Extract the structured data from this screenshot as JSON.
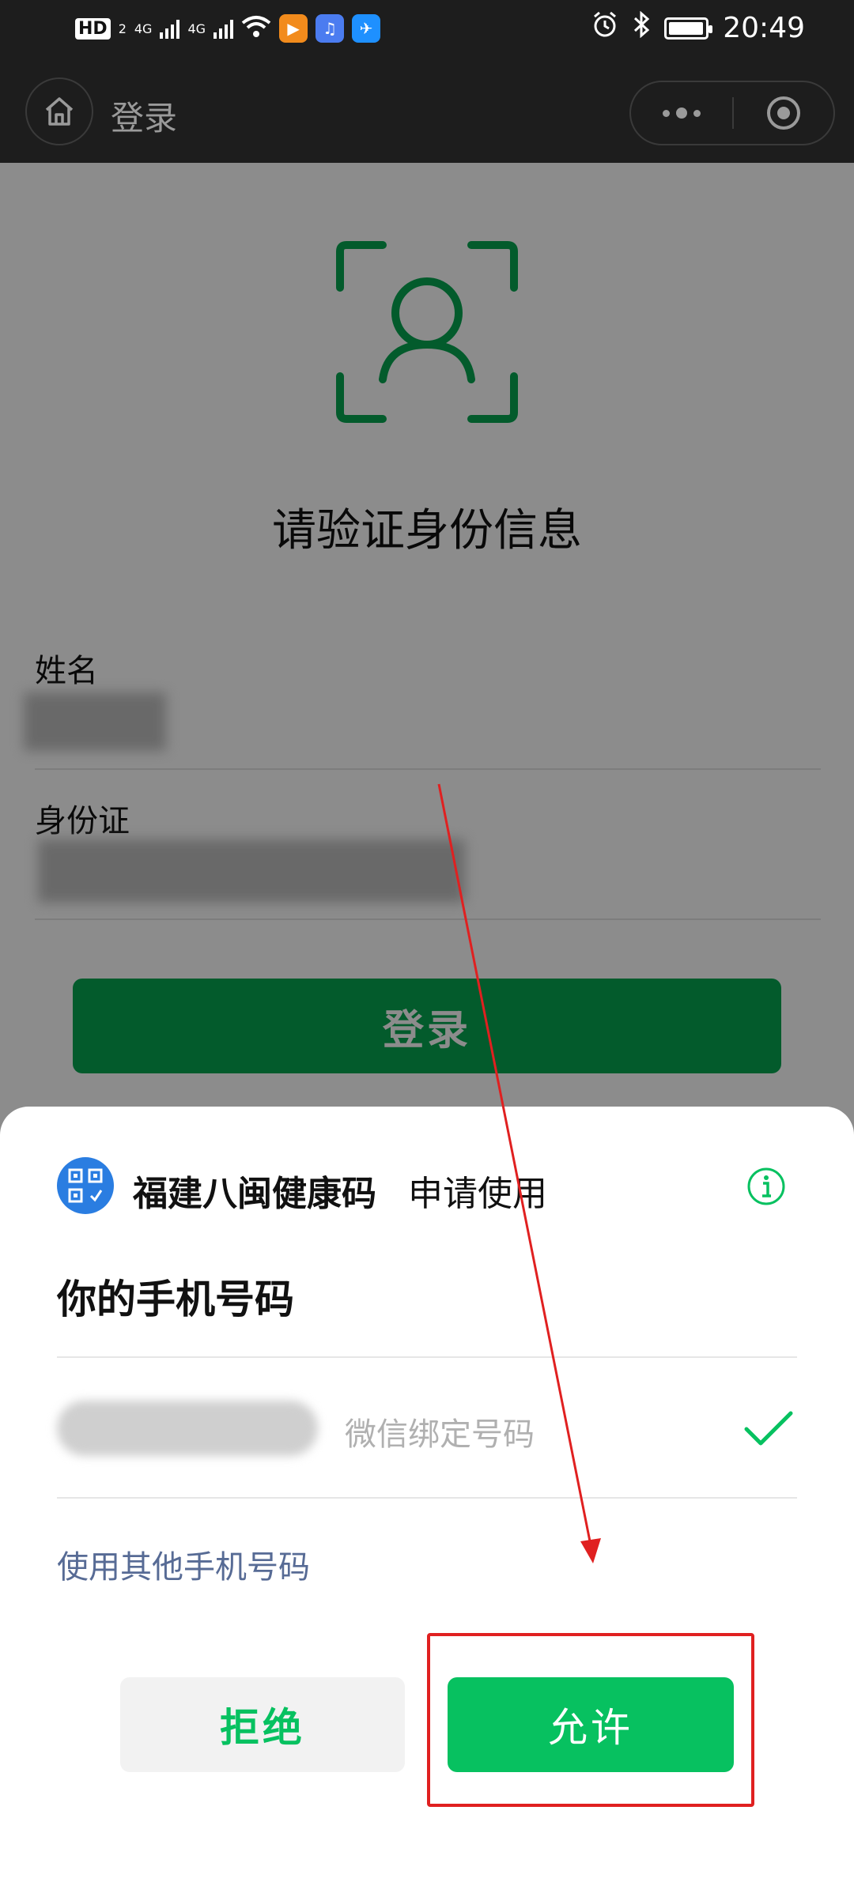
{
  "status_bar": {
    "hd_label": "HD",
    "sim_label": "2",
    "network_1": "4G",
    "network_2": "4G",
    "time": "20:49",
    "battery_level": 0.85
  },
  "nav_bar": {
    "title": "登录",
    "icons": [
      "home-icon",
      "more-icon",
      "close-target-icon"
    ]
  },
  "page": {
    "verify_title": "请验证身份信息",
    "name_label": "姓名",
    "id_label": "身份证",
    "login_button": "登录",
    "accent_color": "#07a651"
  },
  "sheet": {
    "app_name": "福建八闽健康码",
    "request_text": "申请使用",
    "title": "你的手机号码",
    "phone_note": "微信绑定号码",
    "other_phone_link": "使用其他手机号码",
    "reject_button": "拒绝",
    "allow_button": "允许",
    "primary_color": "#07c160",
    "link_color": "#576b95"
  },
  "annotation": {
    "color": "#e02020"
  }
}
